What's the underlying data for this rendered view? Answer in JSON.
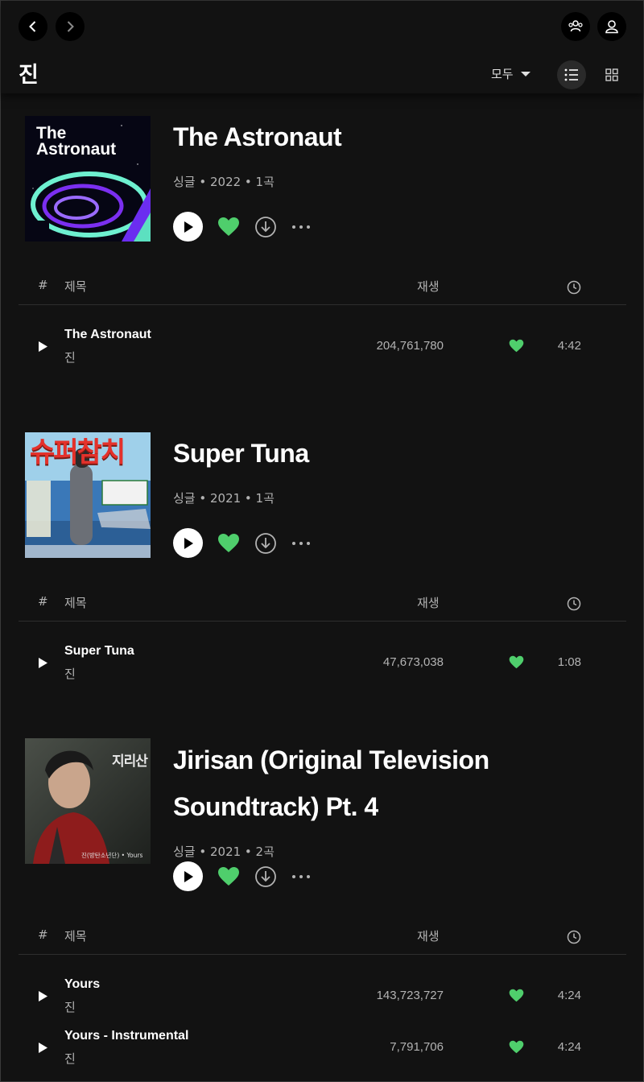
{
  "header": {
    "artist_title": "진",
    "filter_label": "모두",
    "icons": [
      "chevron-left-icon",
      "chevron-right-icon",
      "friends-icon",
      "user-icon",
      "list-view-icon",
      "grid-view-icon"
    ]
  },
  "table_header": {
    "number": "#",
    "title": "제목",
    "plays": "재생"
  },
  "albums": [
    {
      "title": "The Astronaut",
      "meta": "싱글 • 2022 • 1곡",
      "cover_text": "The Astronaut",
      "tracks": [
        {
          "title": "The Astronaut",
          "artist": "진",
          "plays": "204,761,780",
          "duration": "4:42"
        }
      ]
    },
    {
      "title": "Super Tuna",
      "meta": "싱글 • 2021 • 1곡",
      "cover_text": "슈퍼참치",
      "tracks": [
        {
          "title": "Super Tuna",
          "artist": "진",
          "plays": "47,673,038",
          "duration": "1:08"
        }
      ]
    },
    {
      "title": "Jirisan (Original Television Soundtrack) Pt. 4",
      "meta": "싱글 • 2021 • 2곡",
      "cover_text": "지리산",
      "cover_caption": "진(방탄소년단) • Yours",
      "tracks": [
        {
          "title": "Yours",
          "artist": "진",
          "plays": "143,723,727",
          "duration": "4:24"
        },
        {
          "title": "Yours - Instrumental",
          "artist": "진",
          "plays": "7,791,706",
          "duration": "4:24"
        }
      ]
    }
  ],
  "colors": {
    "background": "#121212",
    "accent": "#1ed760",
    "heart": "#4fce6c",
    "muted": "#b3b3b3"
  }
}
